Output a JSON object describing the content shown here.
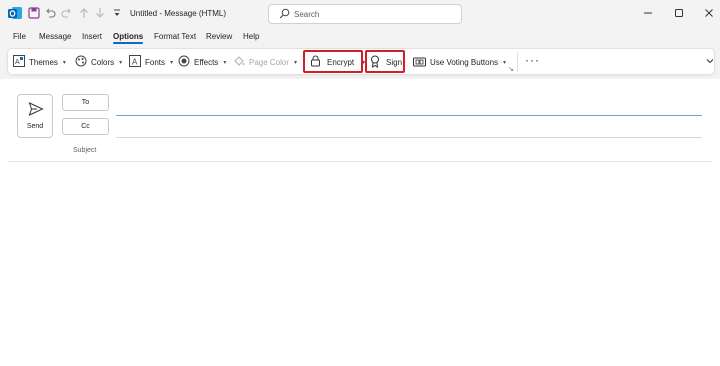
{
  "titlebar": {
    "title": "Untitled - Message (HTML)",
    "search_placeholder": "Search",
    "icons": [
      "outlook-logo",
      "save-icon",
      "undo-icon",
      "redo-icon",
      "up-arrow-icon",
      "down-arrow-icon",
      "customize-qat-icon",
      "minimize-icon",
      "maximize-icon",
      "close-icon"
    ]
  },
  "menu": {
    "tabs": [
      "File",
      "Message",
      "Insert",
      "Options",
      "Format Text",
      "Review",
      "Help"
    ],
    "active": "Options"
  },
  "ribbon": {
    "themes": "Themes",
    "colors": "Colors",
    "fonts": "Fonts",
    "effects": "Effects",
    "page_color": "Page Color",
    "encrypt": "Encrypt",
    "sign": "Sign",
    "voting": "Use Voting Buttons",
    "more": "···",
    "accent": "#0f6cbd",
    "highlight": "#d01f26"
  },
  "compose": {
    "send": "Send",
    "to": "To",
    "cc": "Cc",
    "subject": "Subject"
  }
}
